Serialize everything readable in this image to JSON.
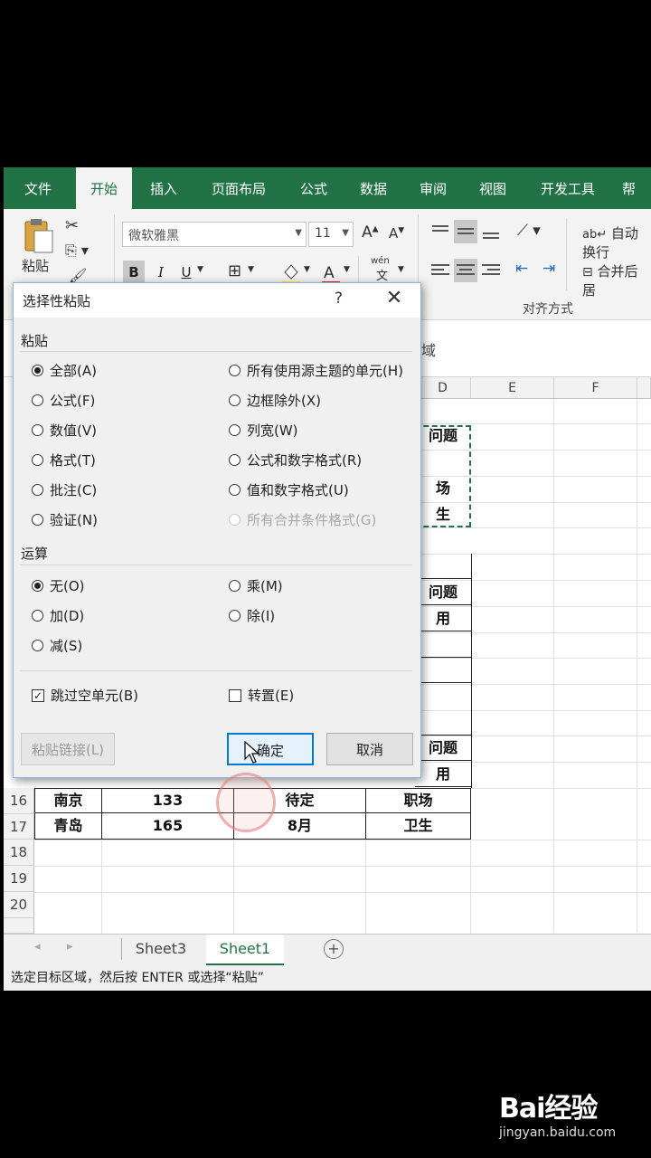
{
  "ribbon": {
    "tabs": [
      "文件",
      "开始",
      "插入",
      "页面布局",
      "公式",
      "数据",
      "审阅",
      "视图",
      "开发工具",
      "帮"
    ],
    "active_tab": "开始",
    "paste_label": "粘贴",
    "font_name": "微软雅黑",
    "font_size": "11",
    "bold": "B",
    "italic": "I",
    "underline": "U",
    "phonetic": "wén",
    "phonetic_char": "文",
    "wrap_text": "自动换行",
    "merge_center": "合并后居",
    "alignment_group": "对齐方式"
  },
  "formula_bar": {
    "name_box_tail": "域"
  },
  "grid": {
    "columns_visible": [
      "D",
      "E",
      "F"
    ],
    "rows": [
      {
        "row": "16",
        "cells": [
          "南京",
          "133",
          "待定",
          "职场"
        ]
      },
      {
        "row": "17",
        "cells": [
          "青岛",
          "165",
          "8月",
          "卫生"
        ]
      },
      {
        "row": "18",
        "cells": []
      },
      {
        "row": "19",
        "cells": []
      },
      {
        "row": "20",
        "cells": []
      }
    ],
    "visible_d_cells": [
      "问题",
      "场",
      "生",
      "问题",
      "用",
      "问题",
      "用"
    ]
  },
  "sheets": {
    "tabs": [
      "Sheet3",
      "Sheet1"
    ],
    "active": "Sheet1"
  },
  "status_bar": {
    "text": "选定目标区域，然后按 ENTER 或选择“粘贴”"
  },
  "dialog": {
    "title": "选择性粘贴",
    "help": "?",
    "close": "✕",
    "paste_section": "粘贴",
    "paste_options_left": [
      {
        "label": "全部(A)",
        "checked": true
      },
      {
        "label": "公式(F)",
        "checked": false
      },
      {
        "label": "数值(V)",
        "checked": false
      },
      {
        "label": "格式(T)",
        "checked": false
      },
      {
        "label": "批注(C)",
        "checked": false
      },
      {
        "label": "验证(N)",
        "checked": false
      }
    ],
    "paste_options_right": [
      {
        "label": "所有使用源主题的单元(H)",
        "checked": false,
        "disabled": false
      },
      {
        "label": "边框除外(X)",
        "checked": false,
        "disabled": false
      },
      {
        "label": "列宽(W)",
        "checked": false,
        "disabled": false
      },
      {
        "label": "公式和数字格式(R)",
        "checked": false,
        "disabled": false
      },
      {
        "label": "值和数字格式(U)",
        "checked": false,
        "disabled": false
      },
      {
        "label": "所有合并条件格式(G)",
        "checked": false,
        "disabled": true
      }
    ],
    "operation_section": "运算",
    "operation_left": [
      {
        "label": "无(O)",
        "checked": true
      },
      {
        "label": "加(D)",
        "checked": false
      },
      {
        "label": "减(S)",
        "checked": false
      }
    ],
    "operation_right": [
      {
        "label": "乘(M)",
        "checked": false
      },
      {
        "label": "除(I)",
        "checked": false
      }
    ],
    "skip_blanks": {
      "label": "跳过空单元(B)",
      "checked": true
    },
    "transpose": {
      "label": "转置(E)",
      "checked": false
    },
    "paste_link": "粘贴链接(L)",
    "ok": "确定",
    "cancel": "取消"
  },
  "watermark": {
    "logo": "Bai经验",
    "url": "jingyan.baidu.com"
  },
  "colors": {
    "excel_green": "#217346",
    "dialog_focus": "#0078d7"
  }
}
